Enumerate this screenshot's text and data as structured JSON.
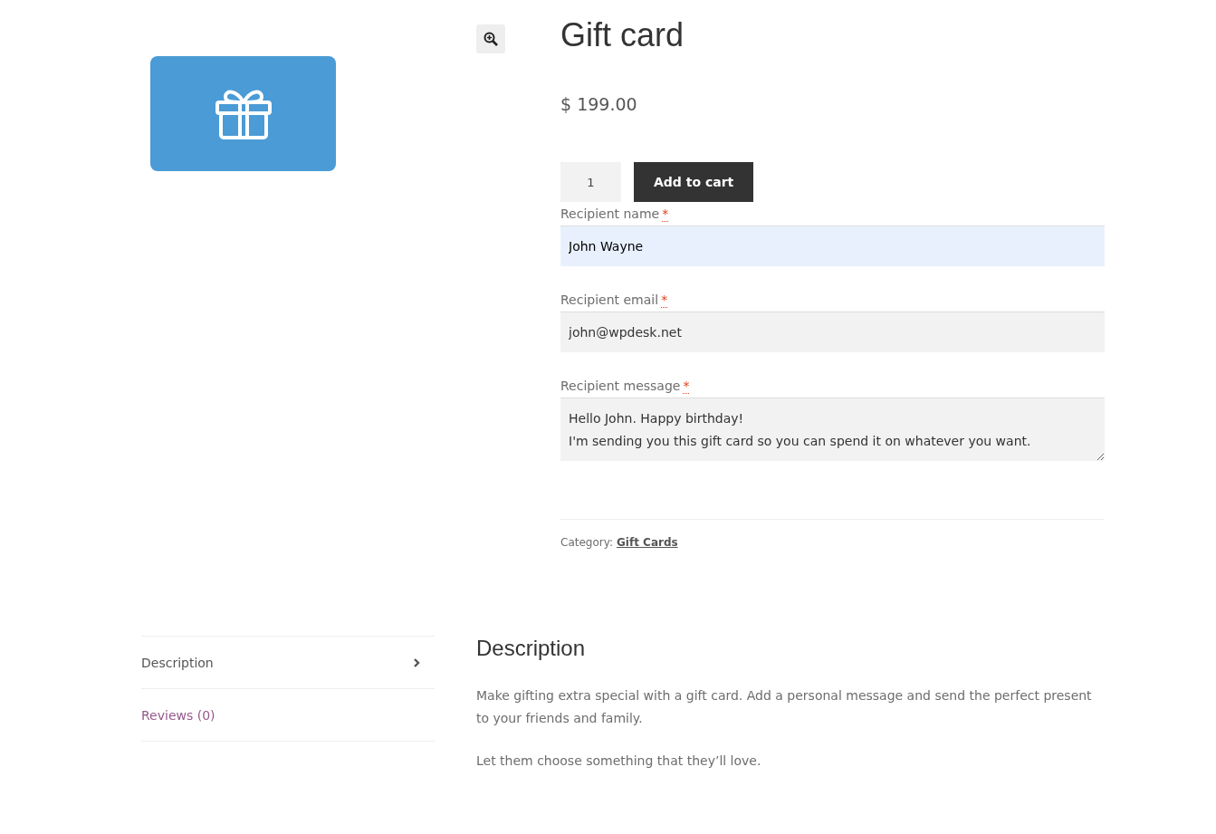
{
  "product": {
    "title": "Gift card",
    "price": "$ 199.00",
    "quantity": "1",
    "add_to_cart": "Add to cart"
  },
  "fields": [
    {
      "kind": "input",
      "label": "Recipient name",
      "required": "*",
      "value": "John Wayne",
      "highlighted": true
    },
    {
      "kind": "input",
      "label": "Recipient email",
      "required": "*",
      "value": "john@wpdesk.net",
      "highlighted": false
    },
    {
      "kind": "textarea",
      "label": "Recipient message",
      "required": "*",
      "value": "Hello John. Happy birthday!\nI'm sending you this gift card so you can spend it on whatever you want.",
      "highlighted": false
    }
  ],
  "meta": {
    "label": "Category:",
    "link": "Gift Cards"
  },
  "tabs": [
    {
      "label": "Description",
      "selected": true
    },
    {
      "label": "Reviews (0)",
      "selected": false
    }
  ],
  "panel": {
    "heading": "Description",
    "paragraphs": [
      "Make gifting extra special with a gift card. Add a personal message and send the perfect present to your friends and family.",
      "Let them choose something that they’ll love."
    ]
  }
}
